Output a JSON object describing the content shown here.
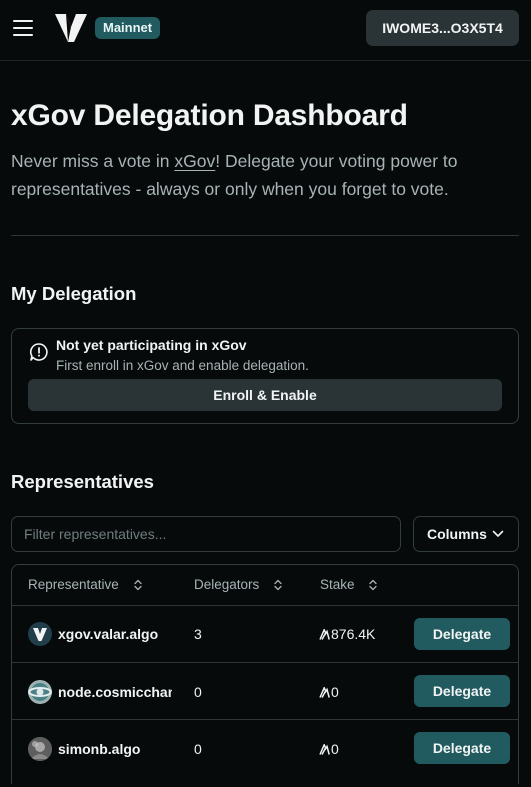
{
  "header": {
    "network": "Mainnet",
    "wallet": "IWOME3...O3X5T4"
  },
  "hero": {
    "title": "xGov Delegation Dashboard",
    "subtitle_before": "Never miss a vote in ",
    "subtitle_link": "xGov",
    "subtitle_after": "! Delegate your voting power to representatives - always or only when you forget to vote."
  },
  "my_delegation": {
    "title": "My Delegation",
    "notice_title": "Not yet participating in xGov",
    "notice_desc": "First enroll in xGov and enable delegation.",
    "enroll_label": "Enroll & Enable"
  },
  "representatives": {
    "title": "Representatives",
    "filter_placeholder": "Filter representatives...",
    "columns_label": "Columns",
    "headers": {
      "representative": "Representative",
      "delegators": "Delegators",
      "stake": "Stake"
    },
    "rows": [
      {
        "name": "xgov.valar.algo",
        "delegators": "3",
        "stake": "876.4K",
        "action": "Delegate",
        "avatar": "valar-logo-icon"
      },
      {
        "name": "node.cosmicchamp",
        "delegators": "0",
        "stake": "0",
        "action": "Delegate",
        "avatar": "cosmic-avatar-icon"
      },
      {
        "name": "simonb.algo",
        "delegators": "0",
        "stake": "0",
        "action": "Delegate",
        "avatar": "photo-avatar-icon"
      }
    ]
  },
  "colors": {
    "accent": "#215b60",
    "background": "#060a0b",
    "muted_button": "#2a3436"
  }
}
